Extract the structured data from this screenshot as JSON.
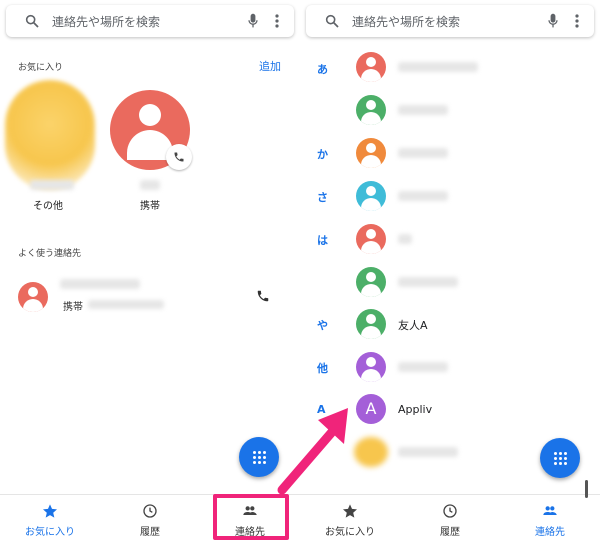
{
  "left": {
    "search": {
      "placeholder": "連絡先や場所を検索"
    },
    "favorites_label": "お気に入り",
    "add_label": "追加",
    "favorites": [
      {
        "name": "その他"
      },
      {
        "name": "携帯"
      }
    ],
    "frequent_label": "よく使う連絡先",
    "frequent_contact": {
      "type": "携帯"
    },
    "bottom_nav": [
      {
        "label": "お気に入り",
        "icon": "star-icon",
        "active": true
      },
      {
        "label": "履歴",
        "icon": "clock-icon",
        "active": false
      },
      {
        "label": "連絡先",
        "icon": "people-icon",
        "active": false
      }
    ]
  },
  "right": {
    "search": {
      "placeholder": "連絡先や場所を検索"
    },
    "index_letters": [
      "あ",
      "か",
      "さ",
      "は",
      "や",
      "他",
      "A"
    ],
    "contacts": [
      {
        "name": "",
        "color": "#ea6a5e"
      },
      {
        "name": "",
        "color": "#4caf68"
      },
      {
        "name": "",
        "color": "#f08a3c"
      },
      {
        "name": "",
        "color": "#3fbcd8"
      },
      {
        "name": "",
        "color": "#ea6a5e"
      },
      {
        "name": "",
        "color": "#4caf68"
      },
      {
        "name": "友人A",
        "color": "#4caf68"
      },
      {
        "name": "",
        "color": "#a45fd8"
      },
      {
        "name": "Appliv",
        "color": "#a45fd8",
        "initial": "A"
      }
    ],
    "bottom_nav": [
      {
        "label": "お気に入り",
        "icon": "star-icon",
        "active": false
      },
      {
        "label": "履歴",
        "icon": "clock-icon",
        "active": false
      },
      {
        "label": "連絡先",
        "icon": "people-icon",
        "active": true
      }
    ]
  },
  "colors": {
    "accent": "#1a73e8",
    "highlight": "#f0247a"
  }
}
